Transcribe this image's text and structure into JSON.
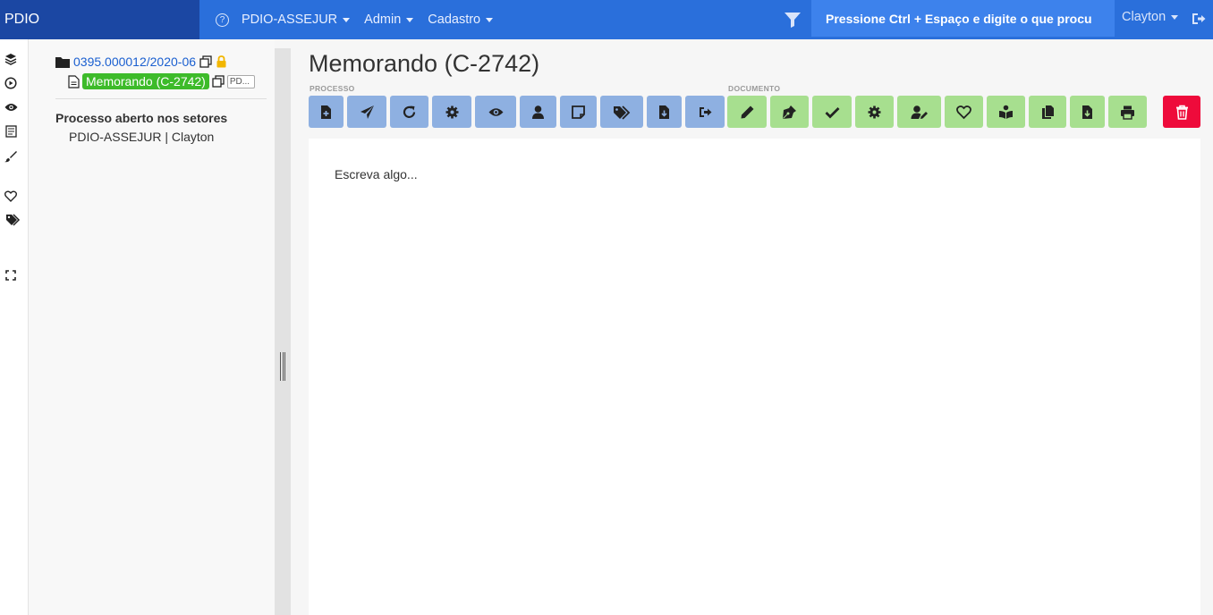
{
  "navbar": {
    "brand": "PDIO",
    "help_icon": "question-circle-icon",
    "menu": [
      {
        "label": "PDIO-ASSEJUR"
      },
      {
        "label": "Admin"
      },
      {
        "label": "Cadastro"
      }
    ],
    "filter_icon": "filter-icon",
    "search_text": "Pressione Ctrl + Espaço e digite o que procu",
    "user": "Clayton",
    "logout_icon": "logout-icon",
    "colors": {
      "bar": "#2a6fdb",
      "brand": "#1b47a3",
      "search": "#3d82ec"
    }
  },
  "rail": [
    "layers-icon",
    "play-circle-icon",
    "eye-icon",
    "newspaper-icon",
    "brush-icon",
    "heart-icon",
    "tags-icon",
    "expand-icon"
  ],
  "tree": {
    "process_number": "0395.000012/2020-06",
    "document_label": "Memorando (C-2742)",
    "document_tag": "PD...",
    "section_title": "Processo aberto nos setores",
    "section_value": "PDIO-ASSEJUR | Clayton"
  },
  "main": {
    "title": "Memorando (C-2742)",
    "group_process": "PROCESSO",
    "group_document": "DOCUMENTO",
    "editor_placeholder": "Escreva algo..."
  },
  "colors": {
    "process_btn": "#8eb0e1",
    "document_btn": "#a7df8f",
    "delete_btn": "#ee0b3b",
    "doc_badge": "#3dbb2a"
  }
}
